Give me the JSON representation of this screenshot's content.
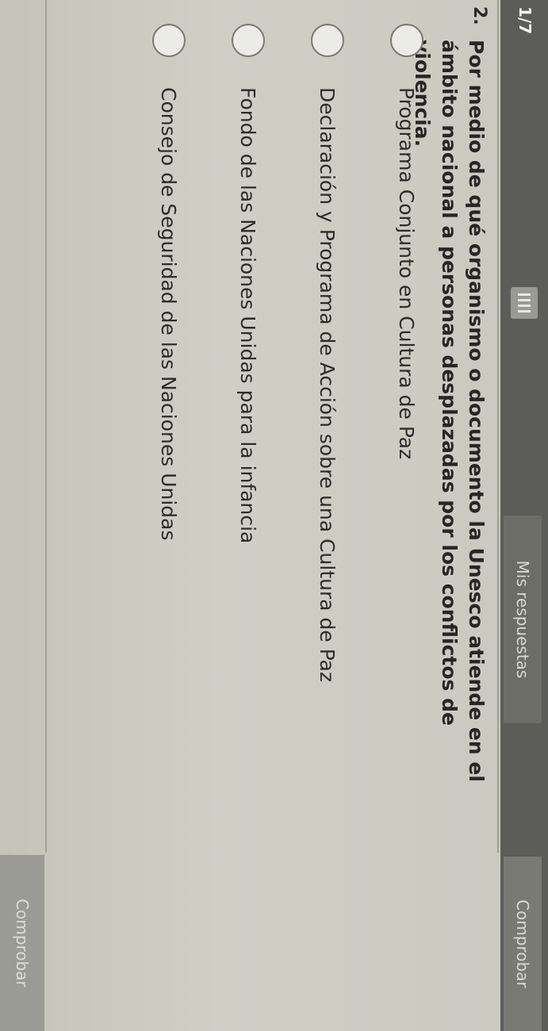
{
  "toolbar": {
    "counter": "1/7",
    "answers_tab": "Mis respuestas",
    "check_tab": "Comprobar",
    "grid_icon": "grid-icon"
  },
  "question": {
    "number": "2.",
    "text": "Por medio de qué organismo o documento la Unesco atiende en el ámbito nacional a personas desplazadas por los conflictos de violencia."
  },
  "options": [
    {
      "label": "Programa Conjunto en Cultura de Paz"
    },
    {
      "label": "Declaración y Programa de Acción sobre una Cultura de Paz"
    },
    {
      "label": "Fondo de las Naciones Unidas para la infancia"
    },
    {
      "label": "Consejo de Seguridad de las Naciones Unidas"
    }
  ],
  "footer": {
    "check_button": "Comprobar"
  }
}
